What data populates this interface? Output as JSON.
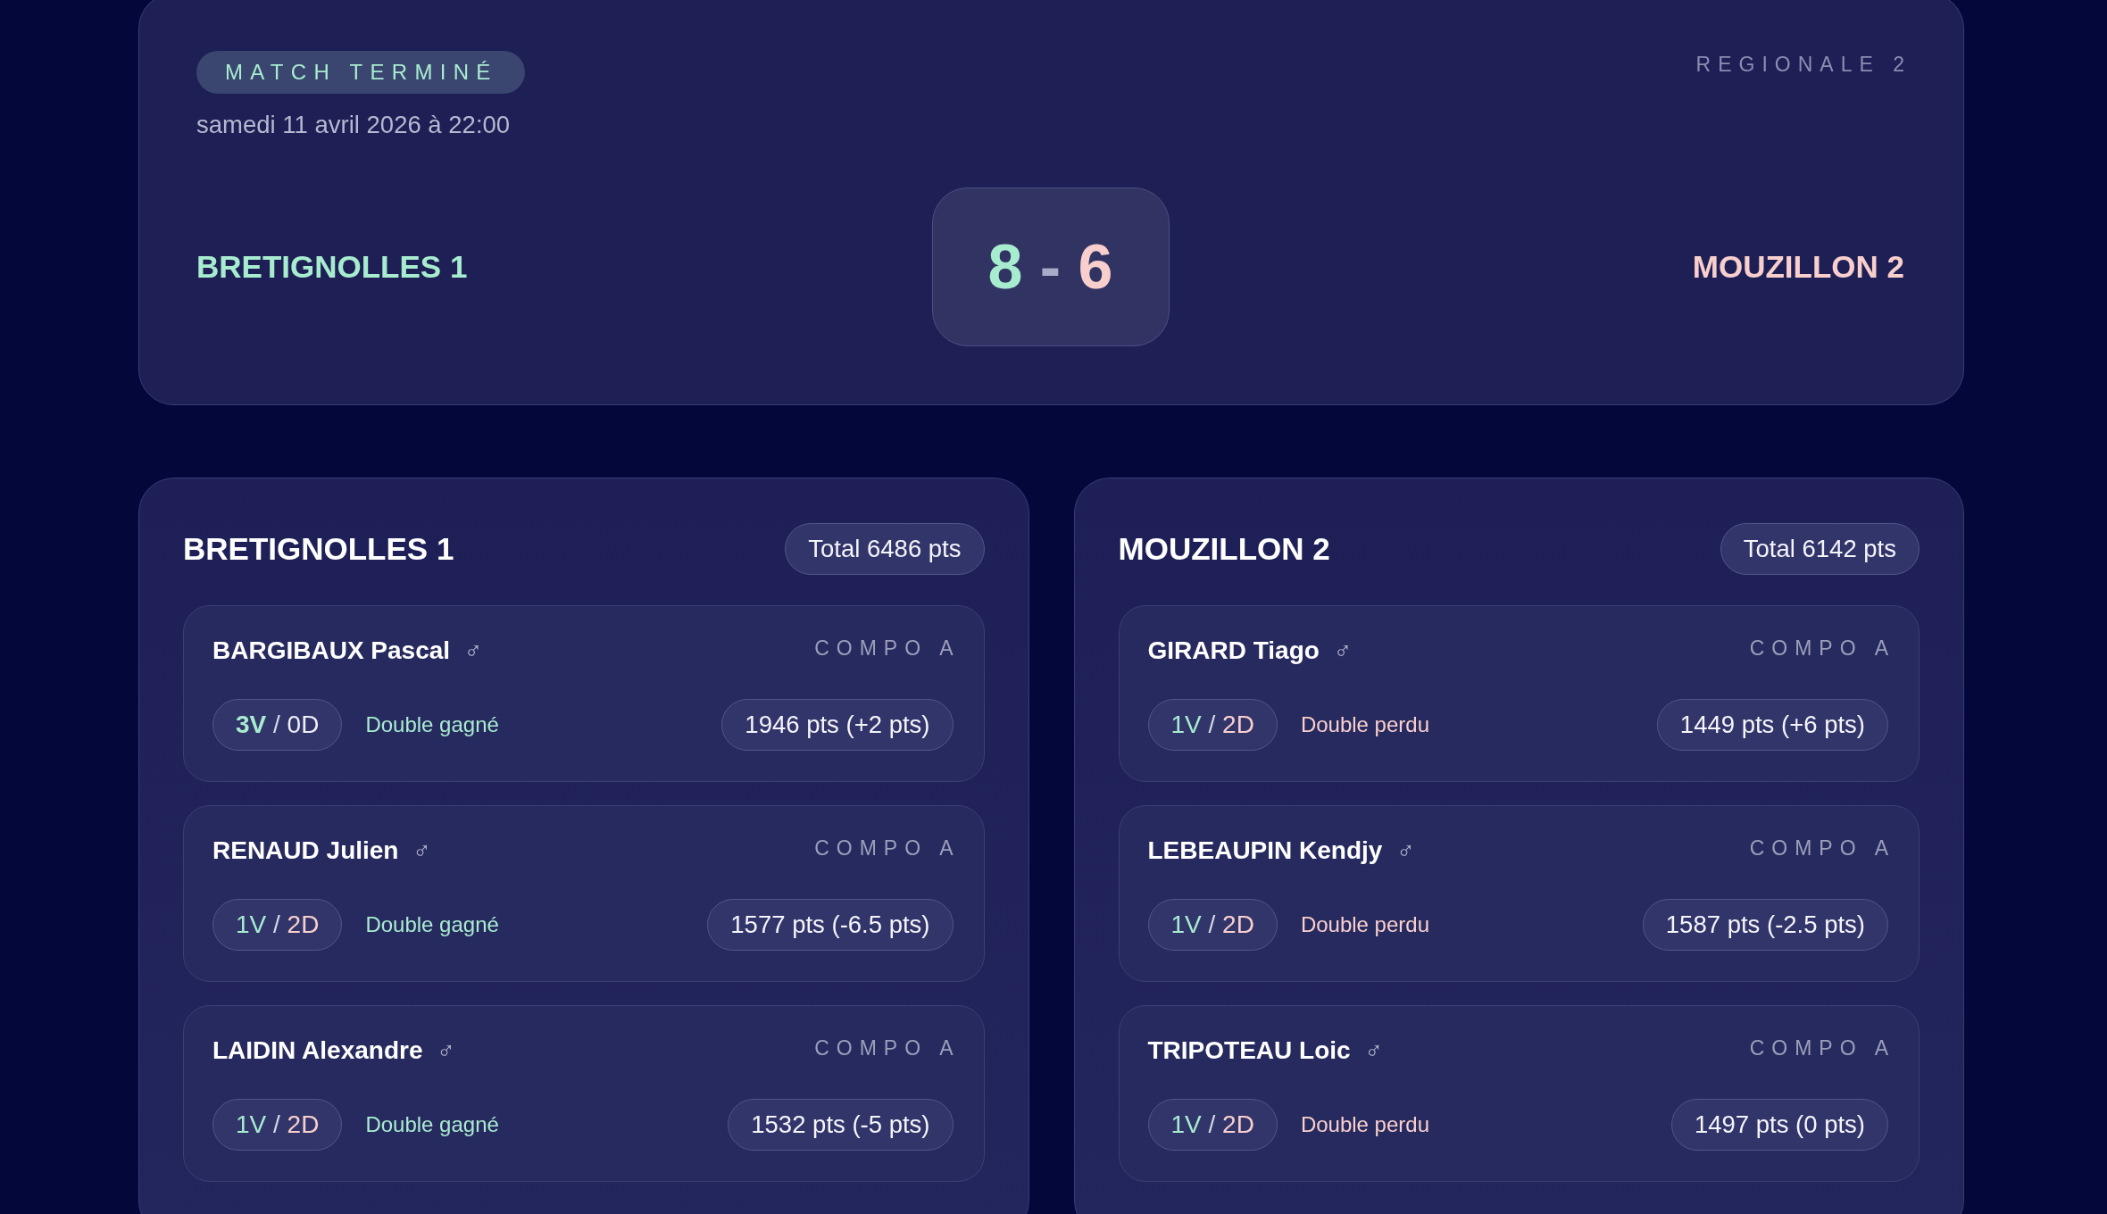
{
  "match": {
    "status": "MATCH TERMINÉ",
    "date": "samedi 11 avril 2026 à 22:00",
    "division": "REGIONALE 2",
    "home_team": "BRETIGNOLLES 1",
    "away_team": "MOUZILLON 2",
    "score": {
      "home": "8",
      "separator": "-",
      "away": "6"
    }
  },
  "teams": [
    {
      "name": "BRETIGNOLLES 1",
      "total": "Total 6486 pts",
      "players": [
        {
          "name": "BARGIBAUX Pascal",
          "gender": "♂",
          "compo": "COMPO A",
          "record": {
            "wins": "3V",
            "separator": "/",
            "losses": "0D",
            "wins_bold": true,
            "losses_marked": false
          },
          "double": {
            "text": "Double gagné",
            "won": true
          },
          "points": "1946 pts (+2 pts)"
        },
        {
          "name": "RENAUD Julien",
          "gender": "♂",
          "compo": "COMPO A",
          "record": {
            "wins": "1V",
            "separator": "/",
            "losses": "2D",
            "wins_bold": false,
            "losses_marked": true
          },
          "double": {
            "text": "Double gagné",
            "won": true
          },
          "points": "1577 pts (-6.5 pts)"
        },
        {
          "name": "LAIDIN Alexandre",
          "gender": "♂",
          "compo": "COMPO A",
          "record": {
            "wins": "1V",
            "separator": "/",
            "losses": "2D",
            "wins_bold": false,
            "losses_marked": true
          },
          "double": {
            "text": "Double gagné",
            "won": true
          },
          "points": "1532 pts (-5 pts)"
        }
      ]
    },
    {
      "name": "MOUZILLON 2",
      "total": "Total 6142 pts",
      "players": [
        {
          "name": "GIRARD Tiago",
          "gender": "♂",
          "compo": "COMPO A",
          "record": {
            "wins": "1V",
            "separator": "/",
            "losses": "2D",
            "wins_bold": false,
            "losses_marked": true
          },
          "double": {
            "text": "Double perdu",
            "won": false
          },
          "points": "1449 pts (+6 pts)"
        },
        {
          "name": "LEBEAUPIN Kendjy",
          "gender": "♂",
          "compo": "COMPO A",
          "record": {
            "wins": "1V",
            "separator": "/",
            "losses": "2D",
            "wins_bold": false,
            "losses_marked": true
          },
          "double": {
            "text": "Double perdu",
            "won": false
          },
          "points": "1587 pts (-2.5 pts)"
        },
        {
          "name": "TRIPOTEAU Loic",
          "gender": "♂",
          "compo": "COMPO A",
          "record": {
            "wins": "1V",
            "separator": "/",
            "losses": "2D",
            "wins_bold": false,
            "losses_marked": true
          },
          "double": {
            "text": "Double perdu",
            "won": false
          },
          "points": "1497 pts (0 pts)"
        }
      ]
    }
  ]
}
